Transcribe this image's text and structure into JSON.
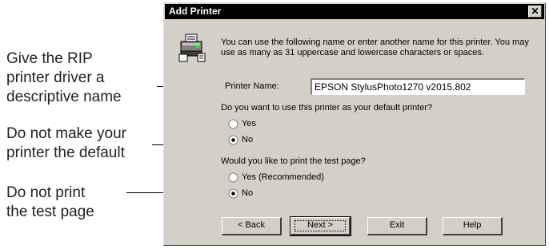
{
  "callouts": [
    {
      "lines": [
        "Give the RIP",
        "printer driver a",
        "descriptive name"
      ]
    },
    {
      "lines": [
        "Do not make your",
        "printer the default"
      ]
    },
    {
      "lines": [
        "Do not print",
        "the test page"
      ]
    }
  ],
  "dialog": {
    "title": "Add Printer",
    "close_label": "✕",
    "intro": "You can use the following name or enter another name for this printer. You may use as many as 31 uppercase and lowercase characters or spaces.",
    "printer_name_label": "Printer Name:",
    "printer_name_value": "EPSON StylusPhoto1270 v2015.802",
    "default_question": "Do you want to use this printer as your default printer?",
    "default_options": [
      {
        "label": "Yes",
        "selected": false
      },
      {
        "label": "No",
        "selected": true
      }
    ],
    "test_question": "Would you like to print the test page?",
    "test_options": [
      {
        "label": "Yes (Recommended)",
        "selected": false
      },
      {
        "label": "No",
        "selected": true
      }
    ],
    "buttons": {
      "back": "< Back",
      "next": "Next >",
      "exit": "Exit",
      "help": "Help"
    }
  }
}
